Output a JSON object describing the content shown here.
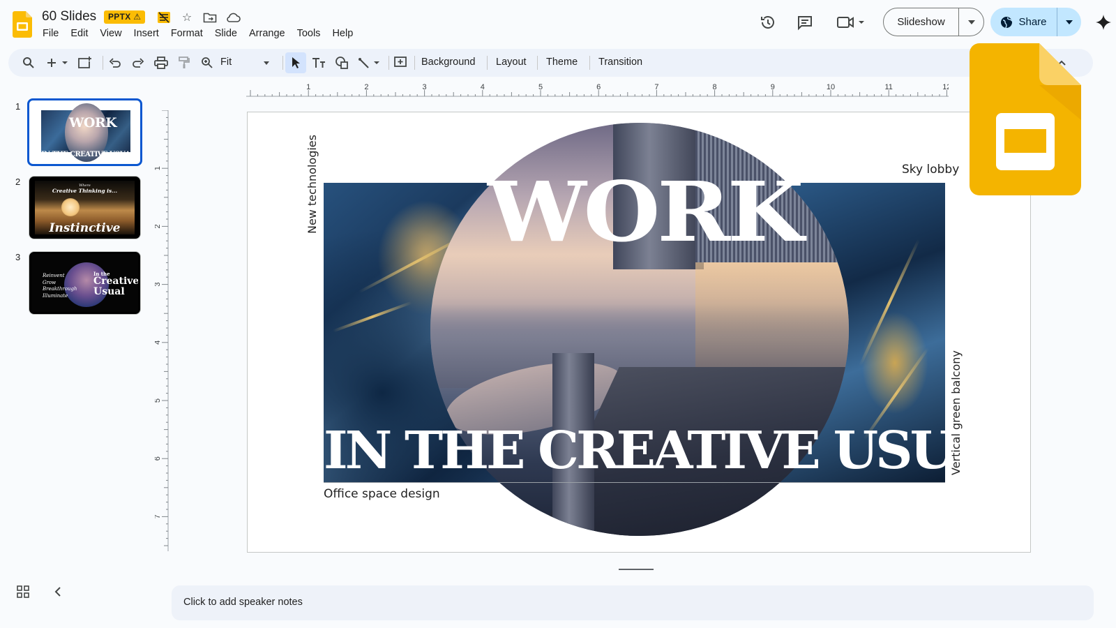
{
  "app": {
    "doc_title": "60 Slides",
    "format_badge": "PPTX",
    "brand_color": "#fbbc04",
    "accent_color": "#0b57d0"
  },
  "menu": [
    "File",
    "Edit",
    "View",
    "Insert",
    "Format",
    "Slide",
    "Arrange",
    "Tools",
    "Help"
  ],
  "header_icons": [
    "history-icon",
    "comment-icon",
    "meet-icon",
    "gemini-icon"
  ],
  "actions": {
    "slideshow_label": "Slideshow",
    "share_label": "Share"
  },
  "toolbar": {
    "zoom_value": "Fit",
    "background_label": "Background",
    "layout_label": "Layout",
    "theme_label": "Theme",
    "transition_label": "Transition"
  },
  "filmstrip": {
    "slides": [
      {
        "number": "1",
        "title": "WORK",
        "subtitle": "IN THE CREATIVE USUAL"
      },
      {
        "number": "2",
        "kicker": "Where",
        "line": "Creative Thinking is...",
        "title": "Instinctive"
      },
      {
        "number": "3",
        "list": [
          "Reinvent",
          "Grow",
          "Breakthrough",
          "Illuminate"
        ],
        "kicker": "In the",
        "title_line1": "Creative",
        "title_line2": "Usual"
      }
    ],
    "selected_index": 1
  },
  "ruler": {
    "h_labels": [
      "1",
      "2",
      "3",
      "4",
      "5",
      "6",
      "7",
      "8",
      "9",
      "10",
      "11",
      "12"
    ],
    "v_labels": [
      "1",
      "2",
      "3",
      "4",
      "5",
      "6",
      "7"
    ]
  },
  "slide": {
    "title_top": "WORK",
    "title_bottom": "IN THE CREATIVE USUAL",
    "label_top_right": "Sky lobby",
    "label_left_vertical": "New technologies",
    "label_right_vertical": "Vertical green balcony",
    "label_bottom_left": "Office space design"
  },
  "notes": {
    "placeholder": "Click to add speaker notes"
  }
}
